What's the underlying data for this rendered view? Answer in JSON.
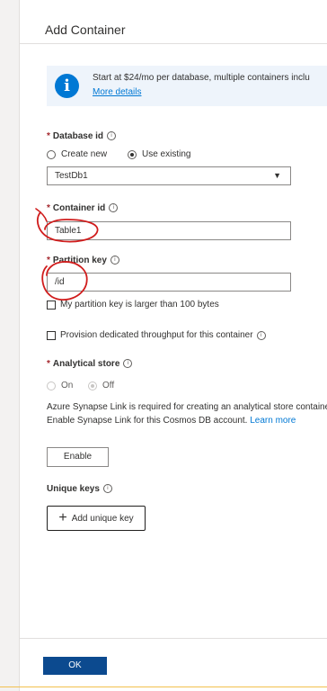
{
  "panel": {
    "title": "Add Container"
  },
  "info_banner": {
    "icon": "info-icon",
    "text": "Start at $24/mo per database, multiple containers inclu",
    "link": "More details"
  },
  "database_id": {
    "label": "Database id",
    "options": [
      "Create new",
      "Use existing"
    ],
    "selected": "Use existing",
    "value": "TestDb1"
  },
  "container_id": {
    "label": "Container id",
    "value": "Table1"
  },
  "partition_key": {
    "label": "Partition key",
    "value": "/id",
    "large_key_label": "My partition key is larger than 100 bytes"
  },
  "throughput": {
    "label": "Provision dedicated throughput for this container"
  },
  "analytical_store": {
    "label": "Analytical store",
    "on_label": "On",
    "off_label": "Off",
    "selected": "Off",
    "note_text": "Azure Synapse Link is required for creating an analytical store container. Enable Synapse Link for this Cosmos DB account. ",
    "note_link": "Learn more",
    "enable_label": "Enable"
  },
  "unique_keys": {
    "label": "Unique keys",
    "add_label": "Add unique key"
  },
  "footer": {
    "ok_label": "OK"
  },
  "colors": {
    "accent": "#0078d4",
    "ok_button": "#0c4a8f",
    "required": "#a4262c",
    "annotation": "#d01c1c"
  }
}
